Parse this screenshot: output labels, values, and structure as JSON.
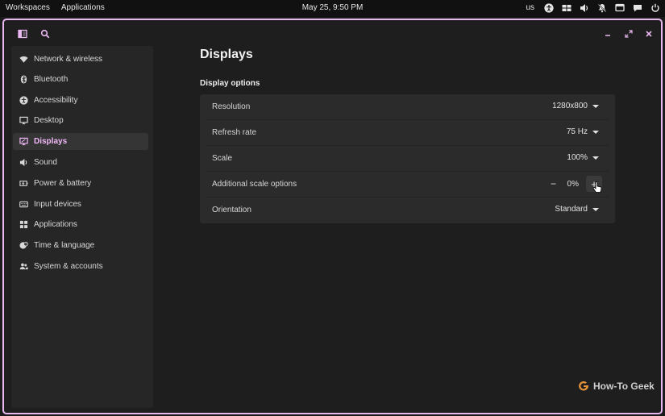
{
  "topbar": {
    "workspaces": "Workspaces",
    "applications": "Applications",
    "clock": "May 25, 9:50 PM",
    "keyboard_layout": "us",
    "tray_icons": [
      "accessibility-icon",
      "workspace-icon",
      "volume-icon",
      "notifications-off-icon",
      "screen-icon",
      "chat-icon",
      "power-icon"
    ]
  },
  "window": {
    "border_color": "#e9b8f0",
    "header_icons": [
      "sidebar-toggle-icon",
      "search-icon",
      "minimize-icon",
      "maximize-icon",
      "close-icon"
    ]
  },
  "sidebar": {
    "accent": "#f2b9f9",
    "items": [
      {
        "label": "Network & wireless",
        "icon": "wifi-icon"
      },
      {
        "label": "Bluetooth",
        "icon": "bluetooth-icon"
      },
      {
        "label": "Accessibility",
        "icon": "accessibility-icon"
      },
      {
        "label": "Desktop",
        "icon": "monitor-icon"
      },
      {
        "label": "Displays",
        "icon": "display-icon",
        "active": true
      },
      {
        "label": "Sound",
        "icon": "speaker-icon"
      },
      {
        "label": "Power & battery",
        "icon": "battery-icon"
      },
      {
        "label": "Input devices",
        "icon": "keyboard-icon"
      },
      {
        "label": "Applications",
        "icon": "apps-grid-icon"
      },
      {
        "label": "Time & language",
        "icon": "globe-clock-icon"
      },
      {
        "label": "System & accounts",
        "icon": "users-icon"
      }
    ]
  },
  "main": {
    "title": "Displays",
    "section": "Display options",
    "rows": {
      "resolution": {
        "label": "Resolution",
        "value": "1280x800"
      },
      "refresh_rate": {
        "label": "Refresh rate",
        "value": "75 Hz"
      },
      "scale": {
        "label": "Scale",
        "value": "100%"
      },
      "additional_scale": {
        "label": "Additional scale options",
        "minus": "−",
        "value": "0%",
        "plus": "+"
      },
      "orientation": {
        "label": "Orientation",
        "value": "Standard"
      }
    }
  },
  "watermark": "How-To Geek"
}
